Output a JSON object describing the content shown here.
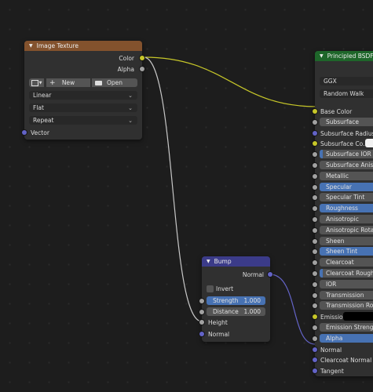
{
  "image_texture": {
    "title": "Image Texture",
    "header_color": "#83522d",
    "outputs": [
      {
        "label": "Color",
        "socket": "yellow"
      },
      {
        "label": "Alpha",
        "socket": "grey"
      }
    ],
    "new_label": "New",
    "open_label": "Open",
    "interpolation": "Linear",
    "projection": "Flat",
    "extension": "Repeat",
    "input_vector": "Vector"
  },
  "bump": {
    "title": "Bump",
    "header_color": "#3b3b89",
    "output": "Normal",
    "invert_label": "Invert",
    "strength_label": "Strength",
    "strength_value": "1.000",
    "distance_label": "Distance",
    "distance_value": "1.000",
    "inputs": [
      "Height",
      "Normal"
    ]
  },
  "bsdf": {
    "title": "Principled BSDF",
    "header_color": "#1e662a",
    "distribution": "GGX",
    "subsurface_method": "Random Walk",
    "rows": [
      {
        "label": "Base Color",
        "type": "socket",
        "socket": "yellow"
      },
      {
        "label": "Subsurface",
        "type": "field",
        "socket": "grey"
      },
      {
        "label": "Subsurface Radius",
        "type": "socket",
        "socket": "purple"
      },
      {
        "label": "Subsurface Co...",
        "type": "color",
        "socket": "yellow"
      },
      {
        "label": "Subsurface IOR",
        "type": "field-partial",
        "socket": "grey"
      },
      {
        "label": "Subsurface Aniso",
        "type": "field",
        "socket": "grey"
      },
      {
        "label": "Metallic",
        "type": "field",
        "socket": "grey"
      },
      {
        "label": "Specular",
        "type": "field-blue",
        "socket": "grey"
      },
      {
        "label": "Specular Tint",
        "type": "field",
        "socket": "grey"
      },
      {
        "label": "Roughness",
        "type": "field-blue",
        "socket": "grey"
      },
      {
        "label": "Anisotropic",
        "type": "field",
        "socket": "grey"
      },
      {
        "label": "Anisotropic Rotati",
        "type": "field",
        "socket": "grey"
      },
      {
        "label": "Sheen",
        "type": "field",
        "socket": "grey"
      },
      {
        "label": "Sheen Tint",
        "type": "field-blue",
        "socket": "grey"
      },
      {
        "label": "Clearcoat",
        "type": "field",
        "socket": "grey"
      },
      {
        "label": "Clearcoat Roughn",
        "type": "field-partial",
        "socket": "grey"
      },
      {
        "label": "IOR",
        "type": "field",
        "socket": "grey"
      },
      {
        "label": "Transmission",
        "type": "field",
        "socket": "grey"
      },
      {
        "label": "Transmission Rou",
        "type": "field",
        "socket": "grey"
      },
      {
        "label": "Emission",
        "type": "color-black",
        "socket": "yellow"
      },
      {
        "label": "Emission Strength",
        "type": "field",
        "socket": "grey"
      },
      {
        "label": "Alpha",
        "type": "field-blue",
        "socket": "grey"
      },
      {
        "label": "Normal",
        "type": "socket",
        "socket": "purple"
      },
      {
        "label": "Clearcoat Normal",
        "type": "socket",
        "socket": "purple"
      },
      {
        "label": "Tangent",
        "type": "socket",
        "socket": "purple"
      }
    ]
  }
}
